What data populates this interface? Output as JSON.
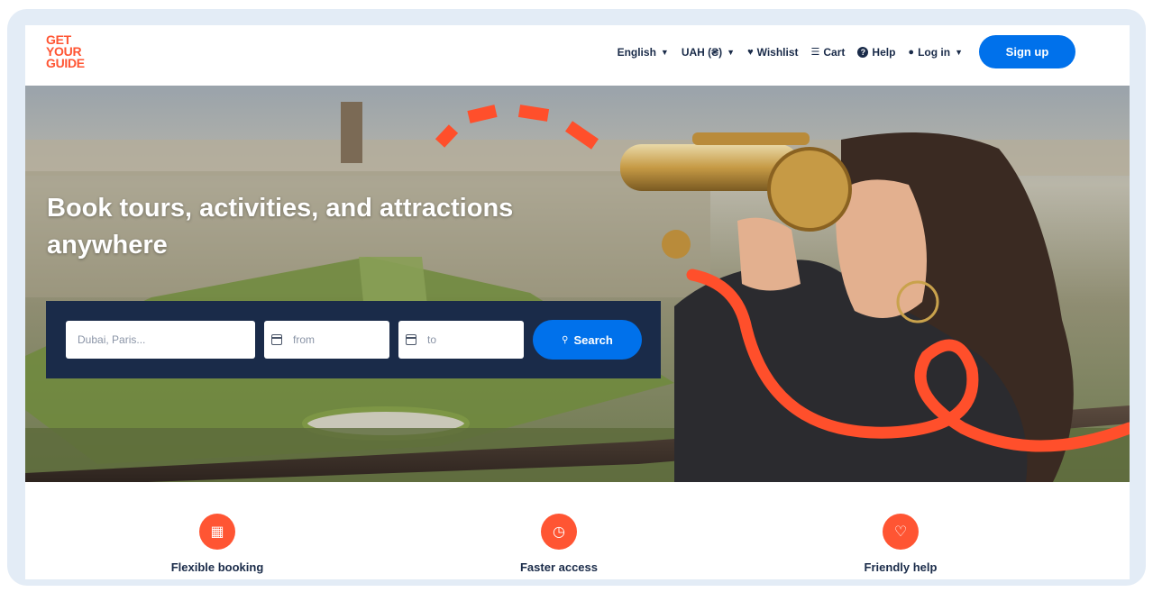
{
  "logo": {
    "line1": "GET",
    "line2": "YOUR",
    "line3": "GUIDE"
  },
  "nav": {
    "language": "English",
    "currency": "UAH (₴)",
    "wishlist": "Wishlist",
    "cart": "Cart",
    "help": "Help",
    "login": "Log in",
    "signup": "Sign up"
  },
  "hero": {
    "headline": "Book tours, activities, and attractions anywhere"
  },
  "search": {
    "where_placeholder": "Dubai, Paris...",
    "from_placeholder": "from",
    "to_placeholder": "to",
    "button": "Search"
  },
  "features": [
    {
      "label": "Flexible booking",
      "icon": "calendar-icon"
    },
    {
      "label": "Faster access",
      "icon": "clock-icon"
    },
    {
      "label": "Friendly help",
      "icon": "heart-icon"
    }
  ],
  "colors": {
    "brand": "#ff5533",
    "primary_button": "#0071eb",
    "search_panel": "#1a2b49",
    "frame": "#e3ecf6"
  }
}
